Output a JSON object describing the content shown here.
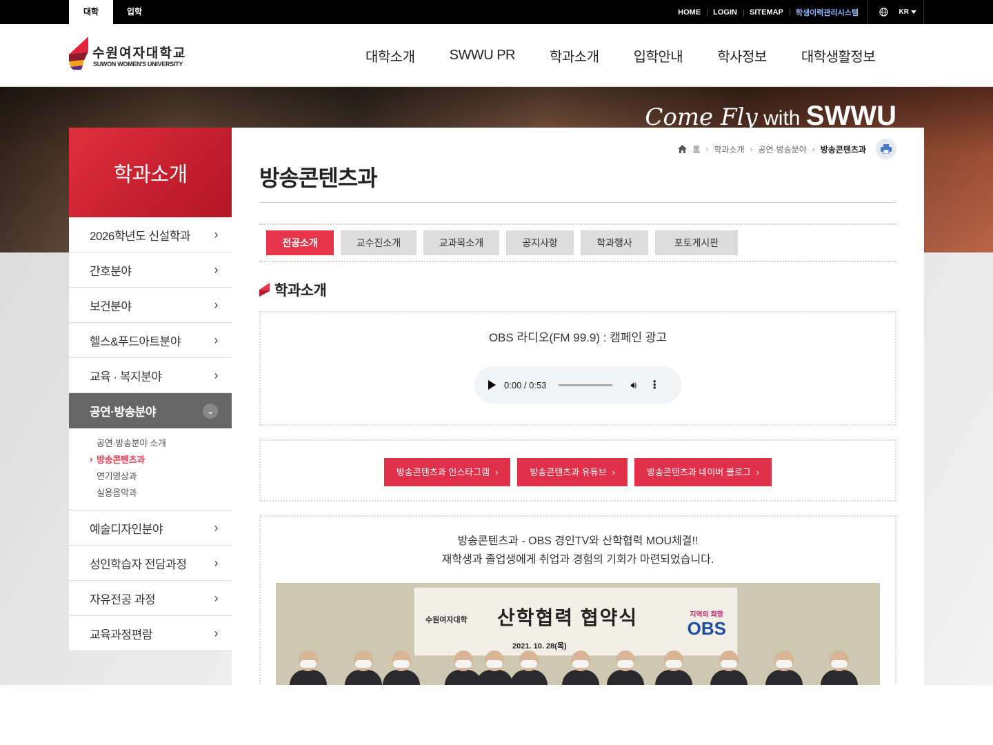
{
  "topbar": {
    "tabs": [
      "대학",
      "입학"
    ],
    "links": [
      "HOME",
      "LOGIN",
      "SITEMAP",
      "학생이력관리시스템"
    ],
    "lang": "KR"
  },
  "header": {
    "logo_kr": "수원여자대학교",
    "logo_en": "SUWON WOMEN'S UNIVERSITY",
    "gnb": [
      "대학소개",
      "SWWU PR",
      "학과소개",
      "입학안내",
      "학사정보",
      "대학생활정보"
    ]
  },
  "visual": {
    "slogan_script": "Come Fly",
    "slogan_with": "with",
    "slogan_brand": "SWWU"
  },
  "lnb": {
    "title": "학과소개",
    "items_top": [
      "2026학년도 신설학과",
      "간호분야",
      "보건분야",
      "헬스&푸드아트분야",
      "교육 · 복지분야"
    ],
    "active": "공연·방송분야",
    "sub": [
      "공연·방송분야 소개",
      "방송콘텐츠과",
      "연기영상과",
      "실용음악과"
    ],
    "items_bottom": [
      "예술디자인분야",
      "성인학습자 전담과정",
      "자유전공 과정",
      "교육과정편람"
    ]
  },
  "breadcrumb": [
    "홈",
    "학과소개",
    "공연·방송분야",
    "방송콘텐츠과"
  ],
  "page_title": "방송콘텐츠과",
  "tabs": [
    "전공소개",
    "교수진소개",
    "교과목소개",
    "공지사항",
    "학과행사",
    "포토게시판"
  ],
  "section_title": "학과소개",
  "audio": {
    "caption": "OBS 라디오(FM 99.9) : 캠페인 광고",
    "time": "0:00 / 0:53"
  },
  "links": [
    "방송콘텐츠과 인스타그램",
    "방송콘텐츠과 유튜브",
    "방송콘텐츠과 네이버 블로그"
  ],
  "news": {
    "line1": "방송콘텐츠과 - OBS 경인TV와 산학협력 MOU체결!!",
    "line2": "재학생과 졸업생에게 취업과 경험의 기회가 마련되었습니다.",
    "photo_logo": "수원여자대학",
    "photo_title": "산학협력 협약식",
    "photo_date": "2021. 10. 28(목)",
    "photo_obs_tag": "지역의 희망",
    "photo_obs": "OBS"
  },
  "colors": {
    "accent": "#e8354a",
    "lnb_head": "#c41e2e",
    "active_nav": "#666666"
  }
}
